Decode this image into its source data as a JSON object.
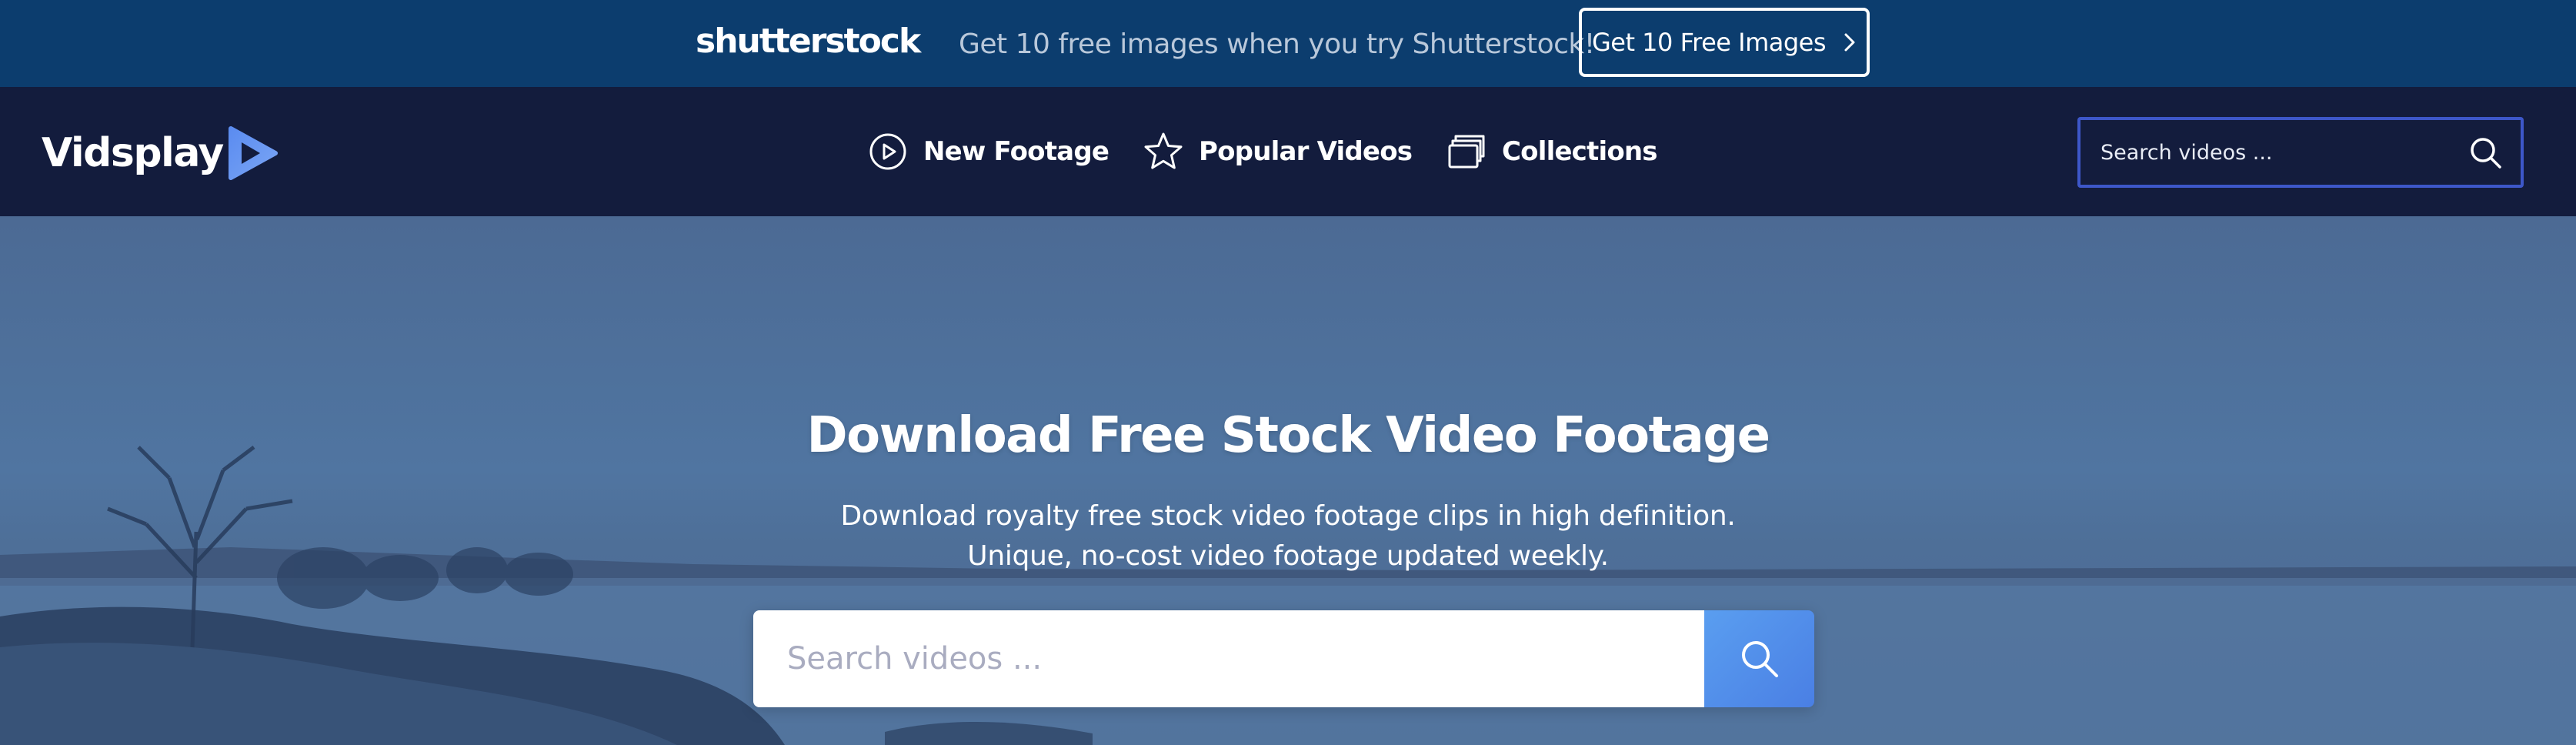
{
  "promo": {
    "logo": "shutterstock",
    "text": "Get 10 free images when you try Shutterstock!",
    "button_label": "Get 10 Free Images",
    "button_icon": "chevron-right-icon"
  },
  "nav": {
    "brand": "Vidsplay",
    "brand_icon": "play-triangle-icon",
    "items": [
      {
        "label": "New Footage",
        "icon": "play-circle-icon"
      },
      {
        "label": "Popular Videos",
        "icon": "star-icon"
      },
      {
        "label": "Collections",
        "icon": "collections-icon"
      }
    ],
    "search": {
      "placeholder": "Search videos ...",
      "icon": "search-icon"
    }
  },
  "hero": {
    "title": "Download Free Stock Video Footage",
    "subtitle_line1": "Download royalty free stock video footage clips in high definition.",
    "subtitle_line2": "Unique, no-cost video footage updated weekly.",
    "search": {
      "placeholder": "Search videos ...",
      "icon": "search-icon"
    }
  },
  "colors": {
    "promo_bg": "#0c3d6e",
    "nav_bg": "#131c3d",
    "nav_search_border": "#3d57c9",
    "search_button": "#4f8ae8",
    "hero_tint": "#4e719c"
  }
}
